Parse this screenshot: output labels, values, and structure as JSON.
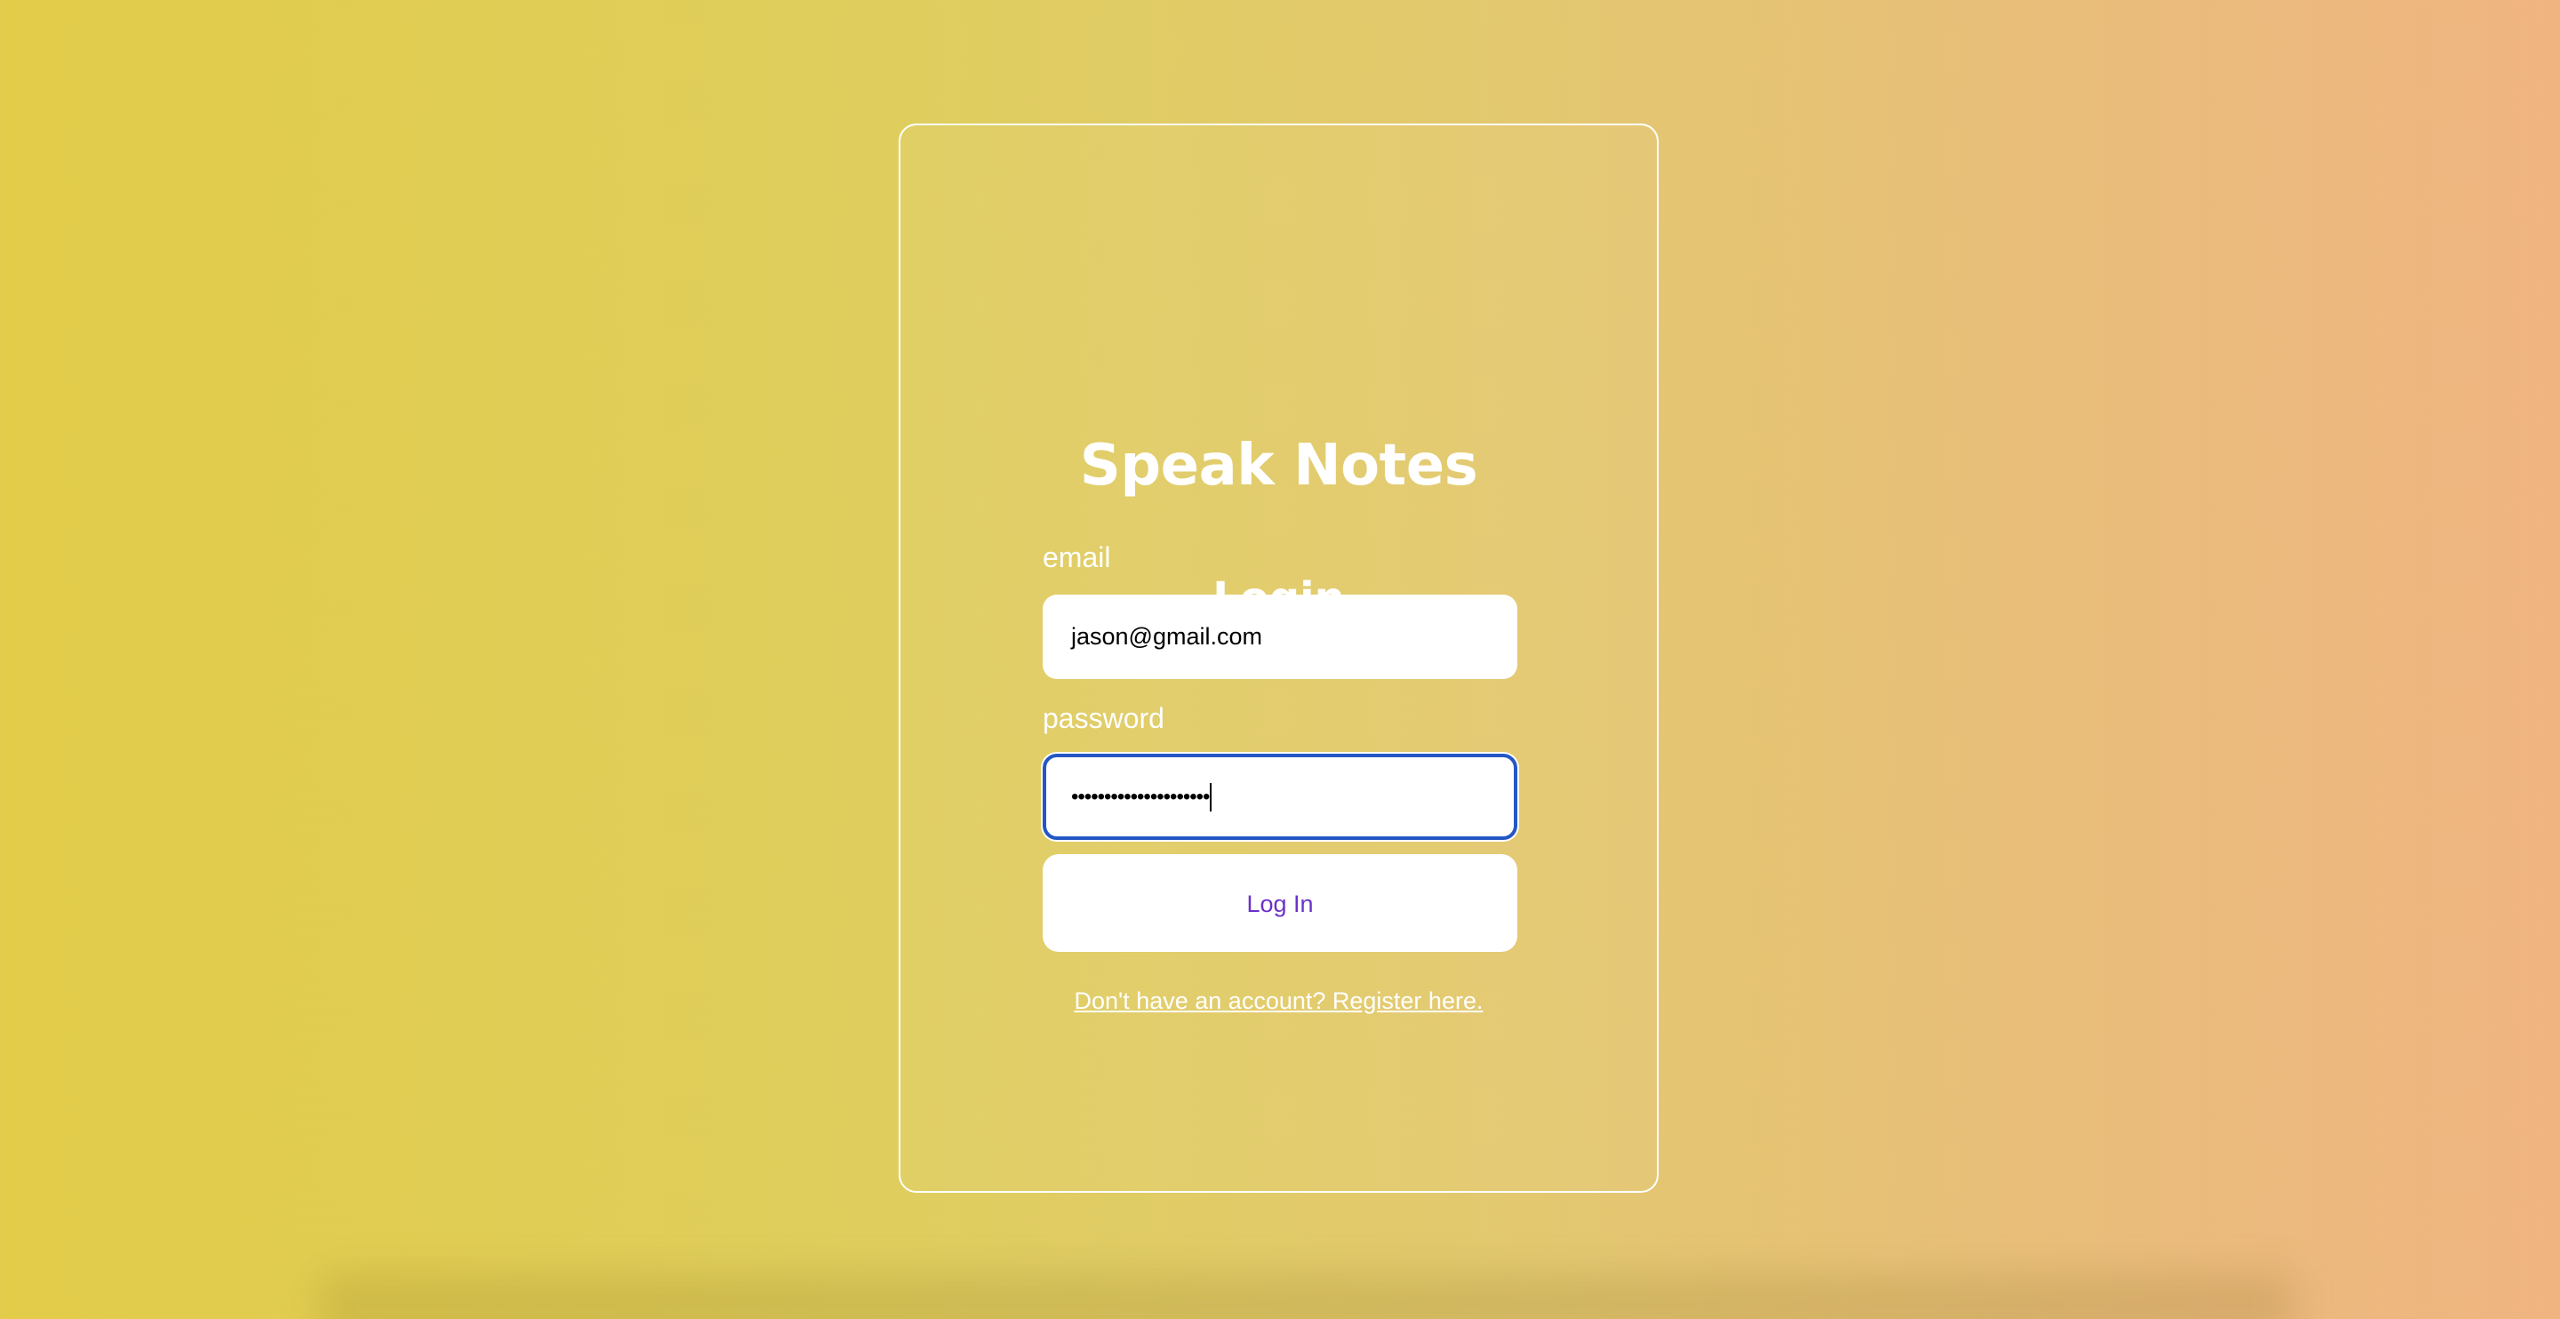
{
  "app": {
    "title": "Speak Notes"
  },
  "login_form": {
    "heading": "Login",
    "email": {
      "label": "email",
      "value": "jason@gmail.com"
    },
    "password": {
      "label": "password",
      "value": "•••••••••••••••••••••"
    },
    "submit_label": "Log In",
    "register_link": "Don't have an account? Register here."
  },
  "colors": {
    "background_start": "#e2cc49",
    "background_end": "#f0b481",
    "button_text": "#6a32c9",
    "focus_ring": "#2457c5"
  }
}
